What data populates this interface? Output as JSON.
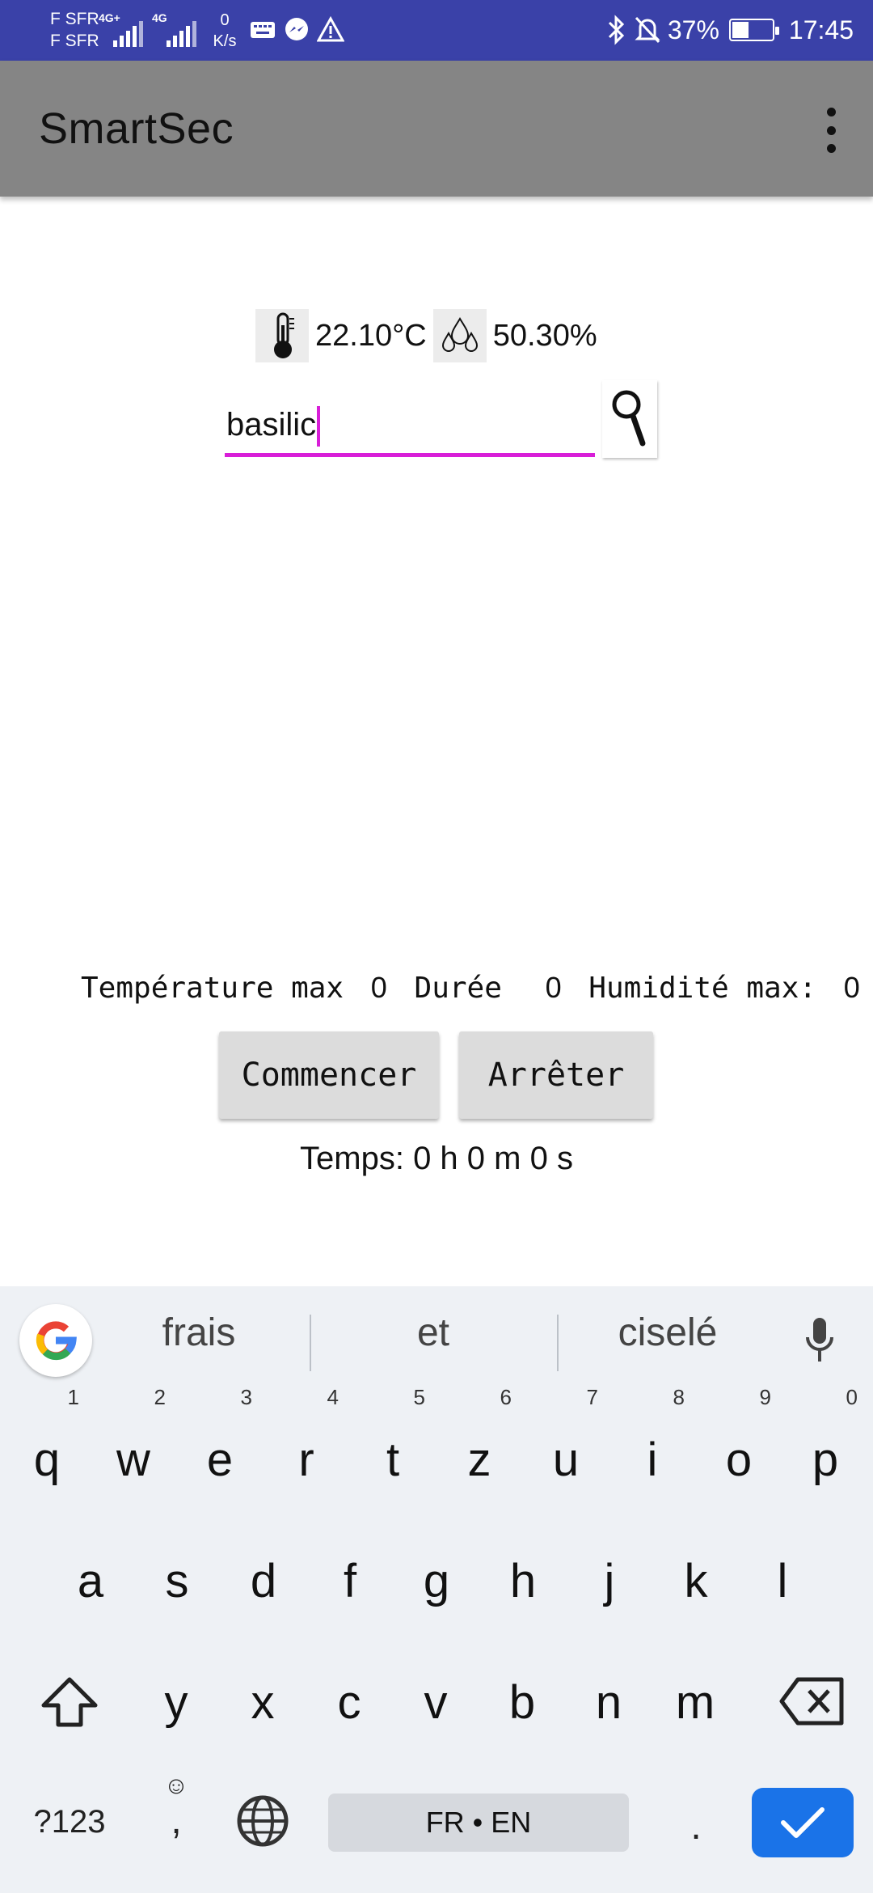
{
  "status_bar": {
    "carrier_1": "F SFR",
    "carrier_2": "F SFR",
    "net_1": "4G+",
    "net_2": "4G",
    "speed_value": "0",
    "speed_unit": "K/s",
    "battery": "37%",
    "time": "17:45",
    "bg_color": "#3a41a8"
  },
  "app_bar": {
    "title": "SmartSec",
    "bg_color": "#858585"
  },
  "sensors": {
    "temperature": "22.10°C",
    "humidity": "50.30%"
  },
  "search": {
    "value": "basilic",
    "accent_color": "#d81ed8"
  },
  "settings": {
    "temp_max_label": "Température max",
    "temp_max_value": "0",
    "duration_label": "Durée",
    "duration_value": "0",
    "humidity_max_label": "Humidité max:",
    "humidity_max_value": "0"
  },
  "controls": {
    "start_label": "Commencer",
    "stop_label": "Arrêter",
    "timer_text": "Temps: 0 h 0 m 0 s"
  },
  "keyboard": {
    "suggestions": [
      "frais",
      "et",
      "ciselé"
    ],
    "row1": [
      {
        "k": "q",
        "n": "1"
      },
      {
        "k": "w",
        "n": "2"
      },
      {
        "k": "e",
        "n": "3"
      },
      {
        "k": "r",
        "n": "4"
      },
      {
        "k": "t",
        "n": "5"
      },
      {
        "k": "z",
        "n": "6"
      },
      {
        "k": "u",
        "n": "7"
      },
      {
        "k": "i",
        "n": "8"
      },
      {
        "k": "o",
        "n": "9"
      },
      {
        "k": "p",
        "n": "0"
      }
    ],
    "row2": [
      "a",
      "s",
      "d",
      "f",
      "g",
      "h",
      "j",
      "k",
      "l"
    ],
    "row3": [
      "y",
      "x",
      "c",
      "v",
      "b",
      "n",
      "m"
    ],
    "symbols_label": "?123",
    "comma": ",",
    "space_label": "FR • EN",
    "period": ".",
    "enter_color": "#1a73e8"
  }
}
